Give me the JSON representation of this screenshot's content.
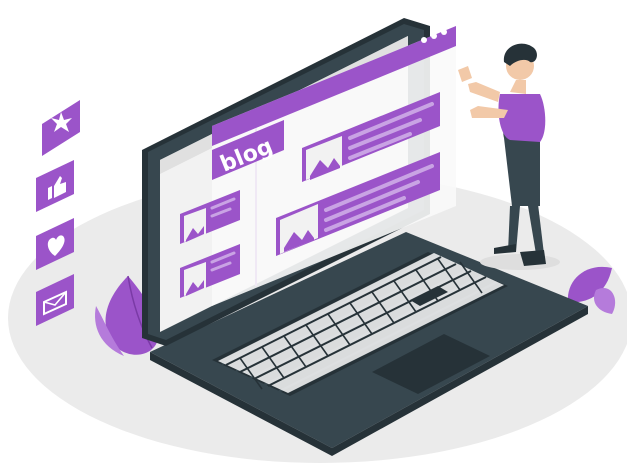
{
  "header": {
    "title": "blog"
  },
  "colors": {
    "accent": "#9b54c9",
    "accent_light": "#c9a3e4",
    "dark": "#37474f",
    "darker": "#263238",
    "screen": "#f2f2f2",
    "floor": "#ebebeb",
    "key": "#fafafa"
  },
  "icons": [
    "star-icon",
    "thumbs-up-icon",
    "heart-icon",
    "mail-icon",
    "image-icon"
  ]
}
